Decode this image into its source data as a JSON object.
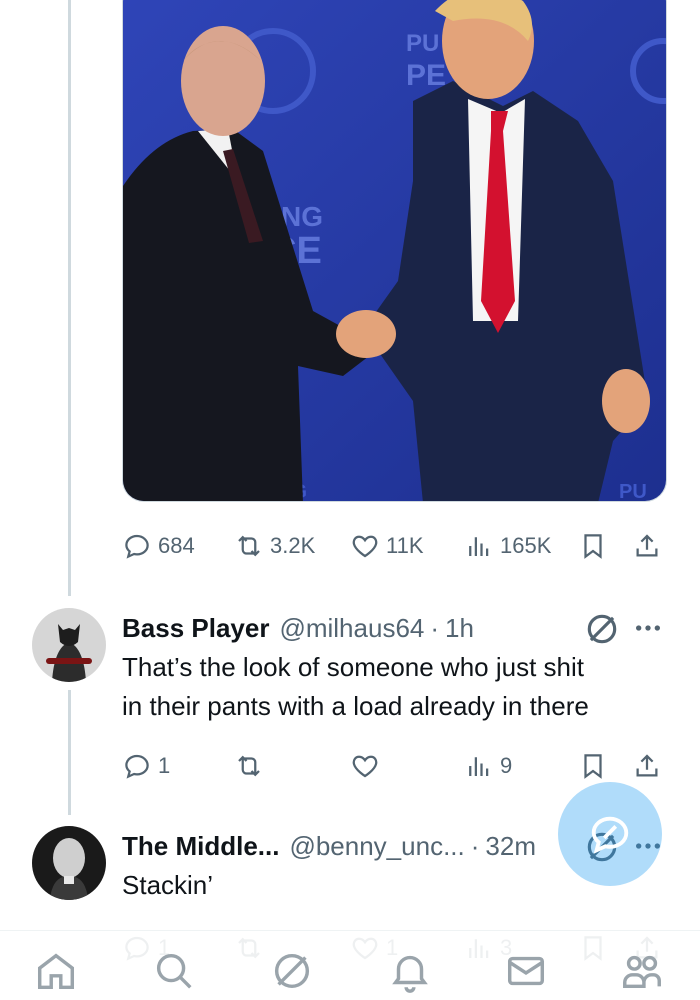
{
  "post": {
    "media": {
      "alt": "",
      "backdrop_text": [
        "PU",
        "PE",
        "UING",
        "CE",
        "NG",
        "PU"
      ]
    },
    "actions": {
      "replies": "684",
      "reposts": "3.2K",
      "likes": "11K",
      "views": "165K"
    }
  },
  "replies": [
    {
      "display_name": "Bass Player",
      "handle": "@milhaus64",
      "time": "1h",
      "text_lines": [
        "That’s the look of someone who just shit",
        "in their pants with a load already in there"
      ],
      "replies": "1",
      "reposts": "",
      "likes": "",
      "views": "9"
    },
    {
      "display_name": "The Middle...",
      "handle": "@benny_unc...",
      "time": "32m",
      "text_lines": [
        "Stackin’"
      ],
      "replies": "1",
      "reposts": "",
      "likes": "1",
      "views": "3"
    }
  ],
  "icons": {
    "reply": "reply-icon",
    "repost": "repost-icon",
    "like": "heart-icon",
    "views": "views-icon",
    "bookmark": "bookmark-icon",
    "share": "share-icon",
    "grok": "grok-icon",
    "more": "more-icon",
    "compose": "compose-icon",
    "nav": [
      "home-icon",
      "search-icon",
      "grok-icon",
      "notifications-icon",
      "messages-icon",
      "communities-icon"
    ]
  },
  "colors": {
    "accent": "#1d9bf0",
    "muted": "#536471",
    "thread_line": "#cfd9de"
  }
}
